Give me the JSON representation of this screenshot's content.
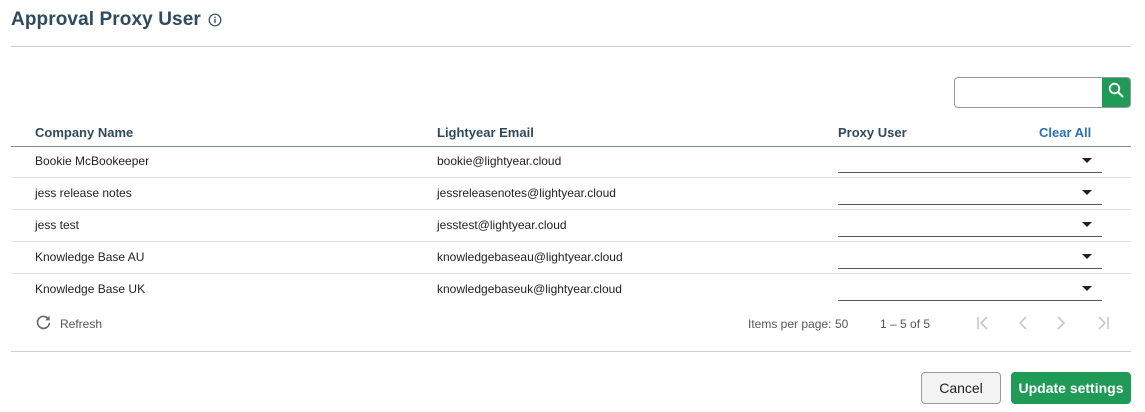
{
  "page": {
    "title": "Approval Proxy User"
  },
  "search": {
    "value": "",
    "placeholder": ""
  },
  "table": {
    "headers": {
      "company": "Company Name",
      "email": "Lightyear Email",
      "proxy": "Proxy User",
      "clear_all": "Clear All"
    },
    "rows": [
      {
        "company": "Bookie McBookeeper",
        "email": "bookie@lightyear.cloud",
        "proxy": ""
      },
      {
        "company": "jess release notes",
        "email": "jessreleasenotes@lightyear.cloud",
        "proxy": ""
      },
      {
        "company": "jess test",
        "email": "jesstest@lightyear.cloud",
        "proxy": ""
      },
      {
        "company": "Knowledge Base AU",
        "email": "knowledgebaseau@lightyear.cloud",
        "proxy": ""
      },
      {
        "company": "Knowledge Base UK",
        "email": "knowledgebaseuk@lightyear.cloud",
        "proxy": ""
      }
    ]
  },
  "footer": {
    "refresh_label": "Refresh",
    "items_per_page_label": "Items per page:",
    "items_per_page_value": "50",
    "range": "1 – 5 of 5"
  },
  "actions": {
    "cancel": "Cancel",
    "update": "Update settings"
  },
  "colors": {
    "accent_green": "#1f9a57",
    "title_navy": "#2d4a5e",
    "link_blue": "#2a6fb8"
  },
  "icons": {
    "info": "info-icon",
    "search": "search-icon",
    "refresh": "refresh-icon",
    "first_page": "first-page-icon",
    "prev_page": "chevron-left-icon",
    "next_page": "chevron-right-icon",
    "last_page": "last-page-icon",
    "dropdown": "chevron-down-icon"
  }
}
